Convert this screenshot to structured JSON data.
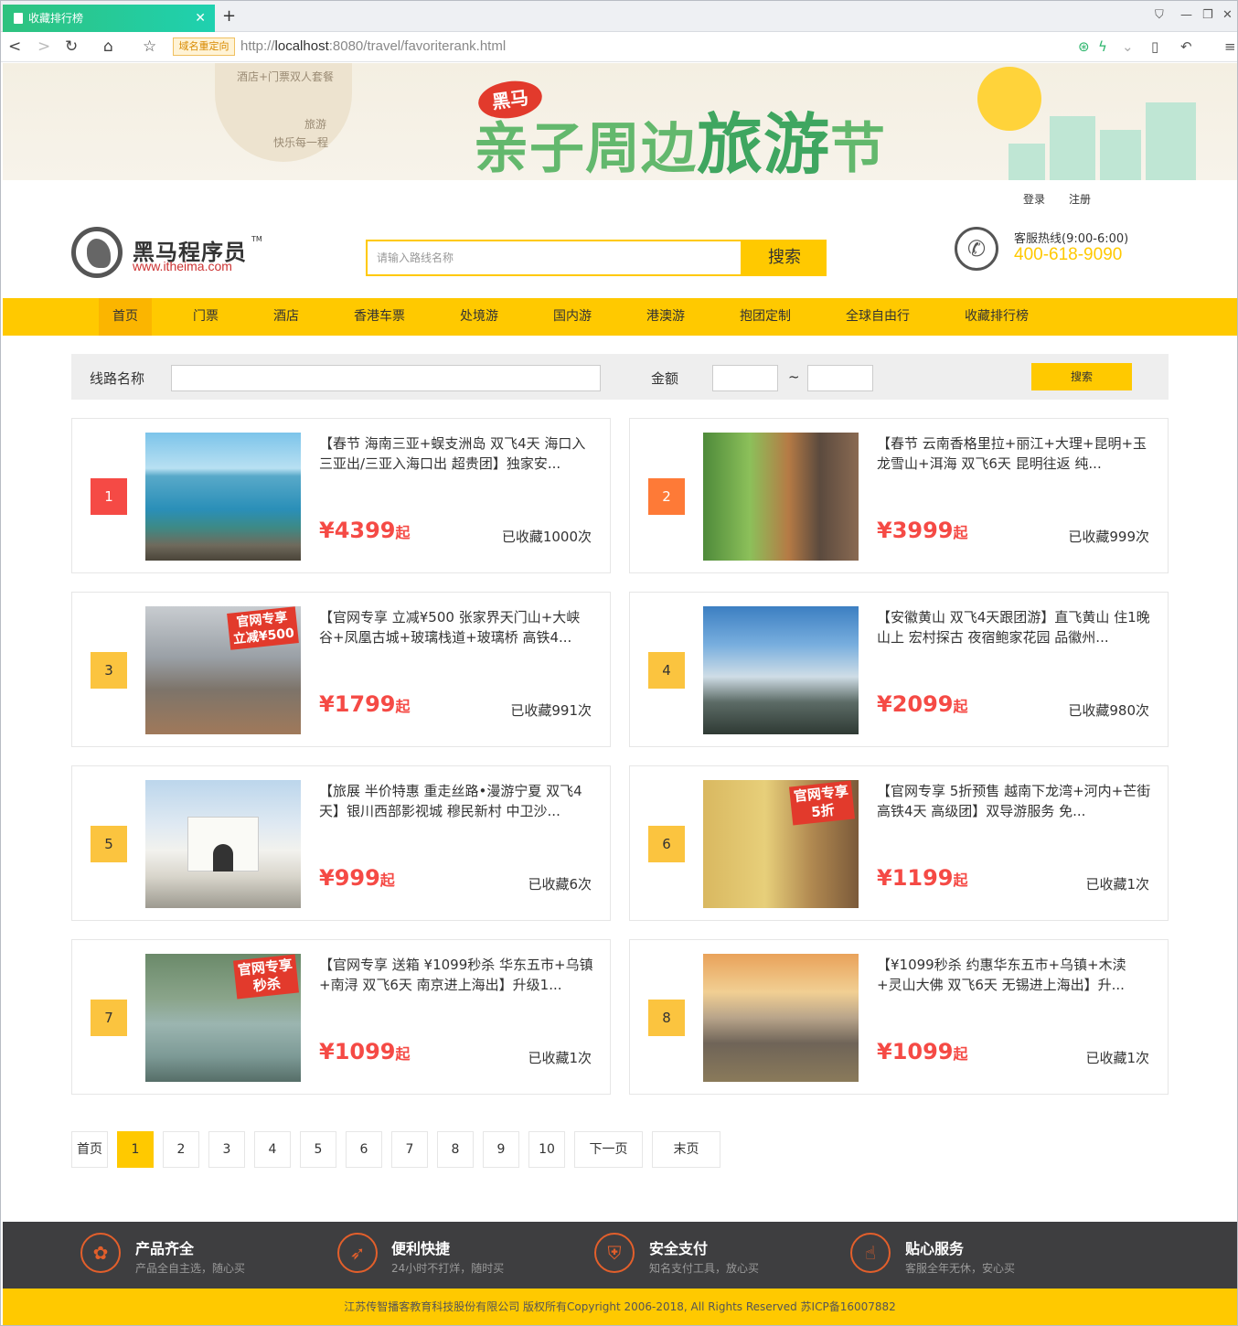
{
  "browser": {
    "tab_title": "收藏排行榜",
    "new_tab": "+",
    "redirect_badge": "域名重定向",
    "url_prefix": "http://",
    "url_host": "localhost",
    "url_rest": ":8080/travel/favoriterank.html"
  },
  "banner": {
    "small1": "酒店+门票双人套餐",
    "small2": "旅游",
    "small3": "快乐每一程",
    "badge": "黑马",
    "title_a": "亲子周边",
    "title_b": "旅游",
    "title_c": "节"
  },
  "toplinks": {
    "login": "登录",
    "register": "注册"
  },
  "header": {
    "logo_title": "黑马程序员",
    "logo_tm": "TM",
    "logo_url": "www.itheima.com",
    "search_placeholder": "请输入路线名称",
    "search_button": "搜索",
    "hotline_label": "客服热线(9:00-6:00)",
    "hotline_number": "400-618-9090"
  },
  "nav": [
    "首页",
    "门票",
    "酒店",
    "香港车票",
    "处境游",
    "国内游",
    "港澳游",
    "抱团定制",
    "全球自由行",
    "收藏排行榜"
  ],
  "filter": {
    "route_label": "线路名称",
    "amount_label": "金额",
    "tilde": "~",
    "button": "搜索"
  },
  "items": [
    {
      "rank": "1",
      "title": "【春节 海南三亚+蜈支洲岛 双飞4天 海口入三亚出/三亚入海口出 超贵团】独家安...",
      "price": "¥4399",
      "suffix": "起",
      "collected": "已收藏1000次"
    },
    {
      "rank": "2",
      "title": "【春节 云南香格里拉+丽江+大理+昆明+玉龙雪山+洱海 双飞6天 昆明往返 纯...",
      "price": "¥3999",
      "suffix": "起",
      "collected": "已收藏999次"
    },
    {
      "rank": "3",
      "title": "【官网专享 立减¥500 张家界天门山+大峡谷+凤凰古城+玻璃栈道+玻璃桥 高铁4...",
      "price": "¥1799",
      "suffix": "起",
      "collected": "已收藏991次"
    },
    {
      "rank": "4",
      "title": "【安徽黄山 双飞4天跟团游】直飞黄山 住1晚山上 宏村探古 夜宿鲍家花园 品徽州...",
      "price": "¥2099",
      "suffix": "起",
      "collected": "已收藏980次"
    },
    {
      "rank": "5",
      "title": "【旅展 半价特惠 重走丝路•漫游宁夏 双飞4天】银川西部影视城 穆民新村 中卫沙...",
      "price": "¥999",
      "suffix": "起",
      "collected": "已收藏6次"
    },
    {
      "rank": "6",
      "title": "【官网专享 5折预售 越南下龙湾+河内+芒街 高铁4天 高级团】双导游服务 免...",
      "price": "¥1199",
      "suffix": "起",
      "collected": "已收藏1次"
    },
    {
      "rank": "7",
      "title": "【官网专享 送箱 ¥1099秒杀 华东五市+乌镇+南浔 双飞6天 南京进上海出】升级1...",
      "price": "¥1099",
      "suffix": "起",
      "collected": "已收藏1次"
    },
    {
      "rank": "8",
      "title": "【¥1099秒杀 约惠华东五市+乌镇+木渎+灵山大佛 双飞6天 无锡进上海出】升...",
      "price": "¥1099",
      "suffix": "起",
      "collected": "已收藏1次"
    }
  ],
  "thumb_stamps": {
    "s3a": "官网专享",
    "s3b": "立减¥500",
    "s6a": "官网专享",
    "s6b": "5折",
    "s7a": "官网专享",
    "s7b": "秒杀"
  },
  "pagination": {
    "first": "首页",
    "pages": [
      "1",
      "2",
      "3",
      "4",
      "5",
      "6",
      "7",
      "8",
      "9",
      "10"
    ],
    "next": "下一页",
    "last": "末页",
    "current": "1"
  },
  "footer": {
    "features": [
      {
        "title": "产品齐全",
        "sub": "产品全自主选，随心买"
      },
      {
        "title": "便利快捷",
        "sub": "24小时不打烊，随时买"
      },
      {
        "title": "安全支付",
        "sub": "知名支付工具，放心买"
      },
      {
        "title": "贴心服务",
        "sub": "客服全年无休，安心买"
      }
    ],
    "copyright": "江苏传智播客教育科技股份有限公司 版权所有Copyright 2006-2018, All Rights Reserved 苏ICP备16007882"
  },
  "colors": {
    "accent": "#ffc900",
    "price": "#f54a45",
    "rank1": "#f54a45",
    "rank2": "#fe7a37",
    "rank_other": "#fbc43f",
    "footer_bg": "#3e3e40"
  }
}
